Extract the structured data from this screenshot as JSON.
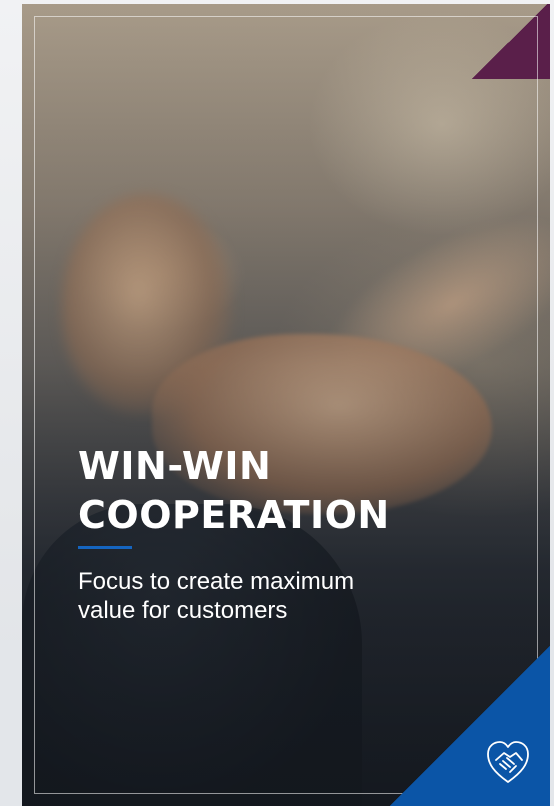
{
  "card": {
    "title_line1": "WIN-WIN",
    "title_line2": "COOPERATION",
    "subtitle": "Focus to create maximum value for customers"
  },
  "icons": {
    "corner_icon": "handshake-icon"
  },
  "colors": {
    "accent_blue": "#0b55a7",
    "underline_blue": "#1565c0",
    "corner_purple": "#5a1f4a",
    "text": "#ffffff"
  }
}
